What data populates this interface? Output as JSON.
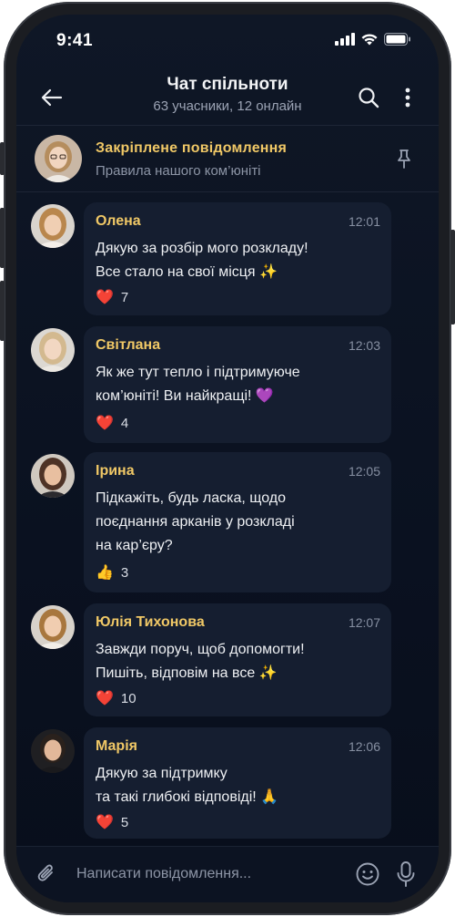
{
  "status_bar": {
    "time": "9:41"
  },
  "header": {
    "title": "Чат спільноти",
    "subtitle": "63 учасники, 12 онлайн"
  },
  "pinned": {
    "title": "Закріплене повідомлення",
    "subtitle": "Правила нашого ком’юніті"
  },
  "messages": [
    {
      "name": "Олена",
      "time": "12:01",
      "lines": [
        "Дякую за розбір мого розкладу!",
        "Все стало на свої місця ✨"
      ],
      "reaction_emoji": "❤️",
      "reaction_count": "7"
    },
    {
      "name": "Світлана",
      "time": "12:03",
      "lines": [
        "Як же тут тепло і підтримуюче",
        "ком’юніті! Ви найкращі! 💜"
      ],
      "reaction_emoji": "❤️",
      "reaction_count": "4"
    },
    {
      "name": "Ірина",
      "time": "12:05",
      "lines": [
        "Підкажіть, будь ласка, щодо",
        "поєднання арканів у розкладі",
        "на кар’єру?"
      ],
      "reaction_emoji": "👍",
      "reaction_count": "3"
    },
    {
      "name": "Юлія Тихонова",
      "time": "12:07",
      "lines": [
        "Завжди поруч, щоб допомогти!",
        "Пишіть, відповім на все ✨"
      ],
      "reaction_emoji": "❤️",
      "reaction_count": "10"
    },
    {
      "name": "Марія",
      "time": "12:06",
      "lines": [
        "Дякую за підтримку",
        "та такі глибокі відповіді! 🙏"
      ],
      "reaction_emoji": "❤️",
      "reaction_count": "5"
    }
  ],
  "composer": {
    "placeholder": "Написати повідомлення..."
  },
  "colors": {
    "background": "#0a1120",
    "bubble": "#151e30",
    "accent_name": "#f0c866",
    "muted_text": "#8d95a6",
    "heart": "#e0245e"
  },
  "icons": {
    "back": "arrow-left-icon",
    "search": "search-icon",
    "more": "more-vertical-icon",
    "pin": "pin-icon",
    "attach": "paperclip-icon",
    "emoji": "smile-icon",
    "mic": "microphone-icon"
  }
}
